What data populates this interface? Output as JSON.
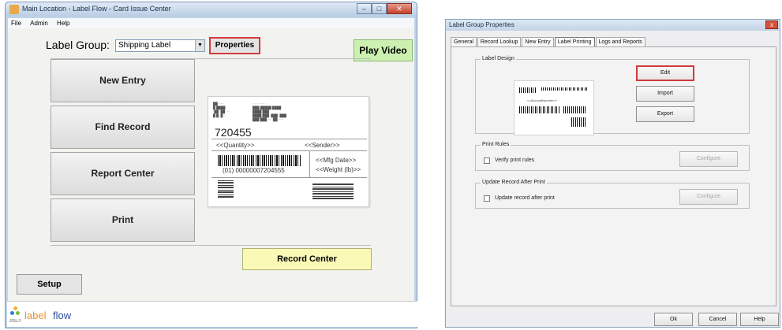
{
  "main_window": {
    "title": "Main Location - Label Flow - Card Issue Center",
    "menu": [
      "File",
      "Admin",
      "Help"
    ],
    "label_group_label": "Label Group:",
    "label_group_value": "Shipping Label",
    "properties_button": "Properties",
    "play_video_button": "Play Video",
    "buttons": [
      "New Entry",
      "Find Record",
      "Report Center",
      "Print"
    ],
    "record_center_button": "Record Center",
    "setup_button": "Setup",
    "logo_brand": "JOLLY",
    "logo_label": "label",
    "logo_flow": "flow",
    "preview": {
      "number": "720455",
      "quantity": "<<Quantity>>",
      "sender": "<<Sender>>",
      "mfg_date": "<<Mfg Date>>",
      "weight": "<<Weight (lb)>>",
      "barcode_text": "(01) 00000007204555"
    }
  },
  "dialog": {
    "title": "Label Group Properties",
    "close": "x",
    "tabs": [
      "General",
      "Record Lookup",
      "New Entry",
      "Label Printing",
      "Logs and Reports"
    ],
    "active_tab": "Label Printing",
    "label_design_group": "Label Design",
    "edit_button": "Edit",
    "import_button": "Import",
    "export_button": "Export",
    "thumb_text": "<<AccountNumber>>",
    "print_rules_group": "Print Rules",
    "verify_print_rules": "Verify print rules",
    "configure_1": "Configure",
    "update_group": "Update Record After Print",
    "update_record": "Update record after print",
    "configure_2": "Configure",
    "ok_button": "Ok",
    "cancel_button": "Cancel",
    "help_button": "Help"
  },
  "colors": {
    "play_video_bg": "#cbf0b0",
    "record_center_bg": "#fafab6",
    "highlight_red": "#d23a3a",
    "logo_orange": "#e8922e",
    "logo_blue": "#2a4c9c"
  }
}
